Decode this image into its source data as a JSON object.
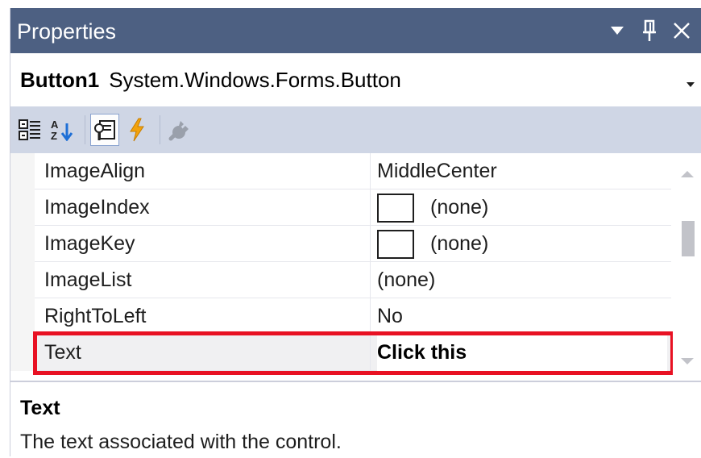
{
  "window": {
    "title": "Properties"
  },
  "object_selector": {
    "name": "Button1",
    "type": "System.Windows.Forms.Button"
  },
  "toolbar": {
    "buttons": [
      "categorized-icon",
      "alphabetical-icon",
      "properties-icon",
      "events-icon",
      "property-pages-icon"
    ],
    "active": "properties-icon"
  },
  "properties": [
    {
      "name": "ImageAlign",
      "value": "MiddleCenter"
    },
    {
      "name": "ImageIndex",
      "value": "(none)"
    },
    {
      "name": "ImageKey",
      "value": "(none)"
    },
    {
      "name": "ImageList",
      "value": "(none)"
    },
    {
      "name": "RightToLeft",
      "value": "No"
    },
    {
      "name": "Text",
      "value": "Click this"
    }
  ],
  "description": {
    "title": "Text",
    "text": "The text associated with the control."
  },
  "colors": {
    "titlebar": "#4d6082",
    "toolbar": "#cfd6e5",
    "highlight": "#e81123"
  }
}
